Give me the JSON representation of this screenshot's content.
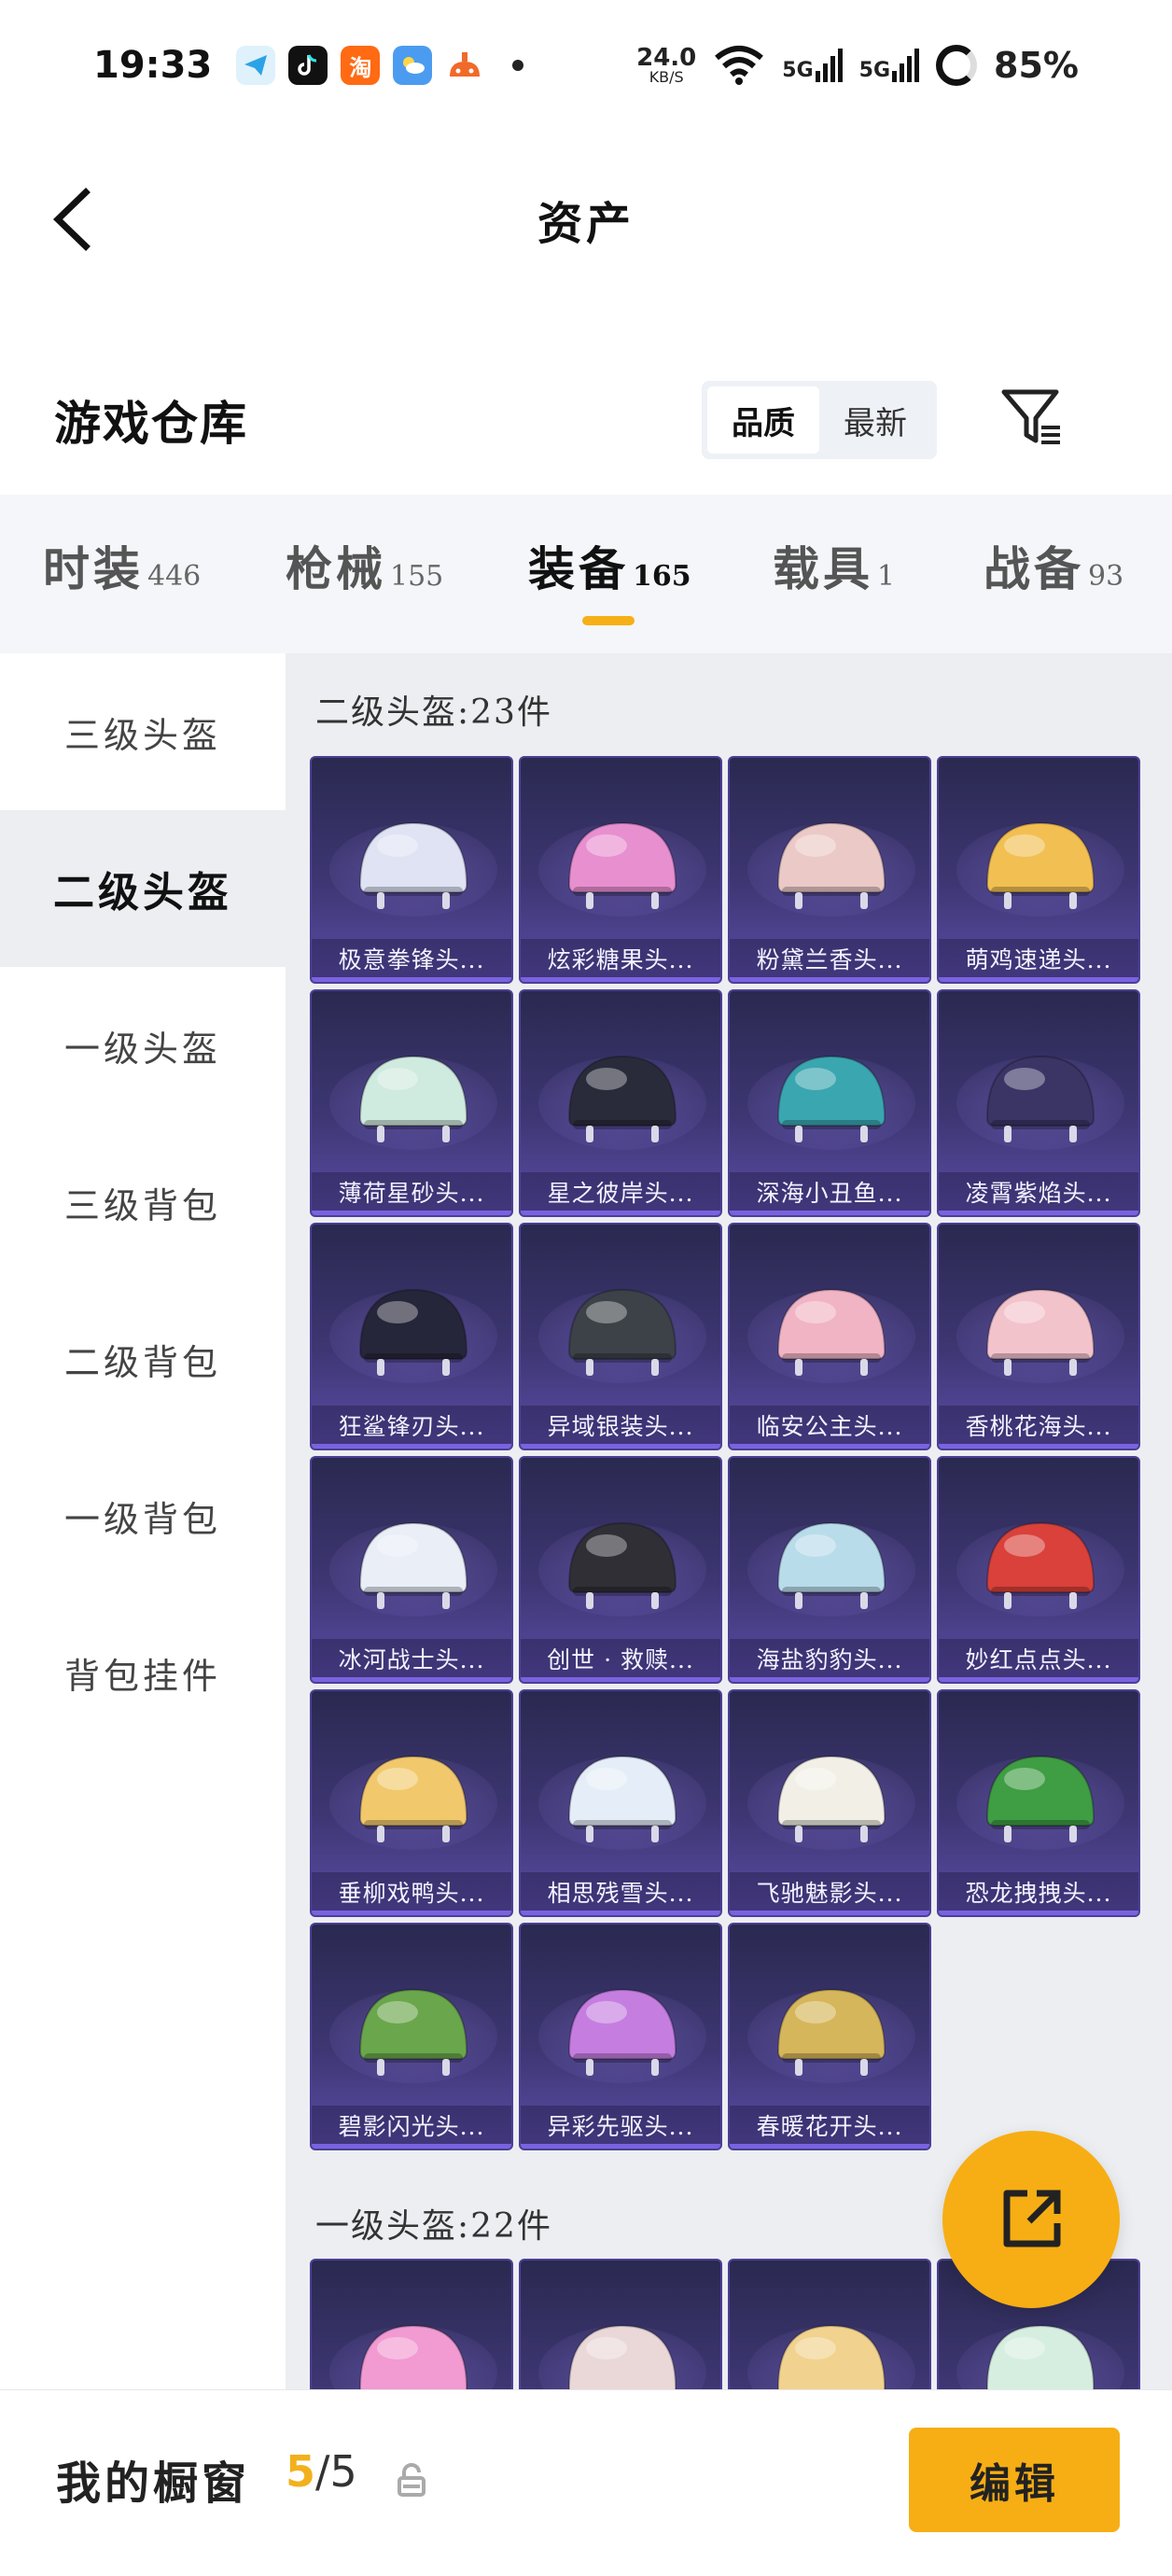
{
  "status_bar": {
    "time": "19:33",
    "net_speed_value": "24.0",
    "net_speed_unit": "KB/S",
    "signal1": "5G",
    "signal2": "5G",
    "battery": "85%",
    "app_icons": [
      "telegram-like-icon",
      "tiktok-icon",
      "taobao-icon",
      "weather-icon",
      "game-icon"
    ]
  },
  "header": {
    "title": "资产"
  },
  "warehouse": {
    "title": "游戏仓库",
    "sort_options": [
      "品质",
      "最新"
    ],
    "active_sort": "品质"
  },
  "category_tabs": [
    {
      "label": "时装",
      "count": "446",
      "active": false
    },
    {
      "label": "枪械",
      "count": "155",
      "active": false
    },
    {
      "label": "装备",
      "count": "165",
      "active": true
    },
    {
      "label": "载具",
      "count": "1",
      "active": false
    },
    {
      "label": "战备",
      "count": "93",
      "active": false
    }
  ],
  "sidebar": {
    "items": [
      "三级头盔",
      "二级头盔",
      "一级头盔",
      "三级背包",
      "二级背包",
      "一级背包",
      "背包挂件"
    ],
    "active_index": 1
  },
  "sections": [
    {
      "title": "二级头盔:23件",
      "items": [
        "极意拳锋头...",
        "炫彩糖果头...",
        "粉黛兰香头...",
        "萌鸡速递头...",
        "薄荷星砂头...",
        "星之彼岸头...",
        "深海小丑鱼...",
        "凌霄紫焰头...",
        "狂鲨锋刃头...",
        "异域银装头...",
        "临安公主头...",
        "香桃花海头...",
        "冰河战士头...",
        "创世 · 救赎...",
        "海盐豹豹头...",
        "妙红点点头...",
        "垂柳戏鸭头...",
        "相思残雪头...",
        "飞驰魅影头...",
        "恐龙拽拽头...",
        "碧影闪光头...",
        "异彩先驱头...",
        "春暖花开头..."
      ],
      "item_colors": [
        "#dfe3f4",
        "#e88fd0",
        "#eac9c6",
        "#f2bf52",
        "#cfeadf",
        "#2a2b3a",
        "#3aa6b0",
        "#3b3566",
        "#26263a",
        "#3c4248",
        "#f1b4c4",
        "#f3c3cc",
        "#e9eef7",
        "#2f2f35",
        "#b9dceb",
        "#d9413a",
        "#f1c96c",
        "#e5eef8",
        "#f2f0e6",
        "#3f9d43",
        "#6aa64b",
        "#c57ee0",
        "#d6b65a"
      ]
    },
    {
      "title": "一级头盔:22件",
      "items": [
        "",
        "",
        "",
        ""
      ],
      "item_colors": [
        "#f29ad2",
        "#ead8d8",
        "#f1d28e",
        "#d6eee0"
      ]
    }
  ],
  "showcase": {
    "label": "我的橱窗",
    "current": "5",
    "separator": "/",
    "total": "5",
    "edit_label": "编辑"
  }
}
